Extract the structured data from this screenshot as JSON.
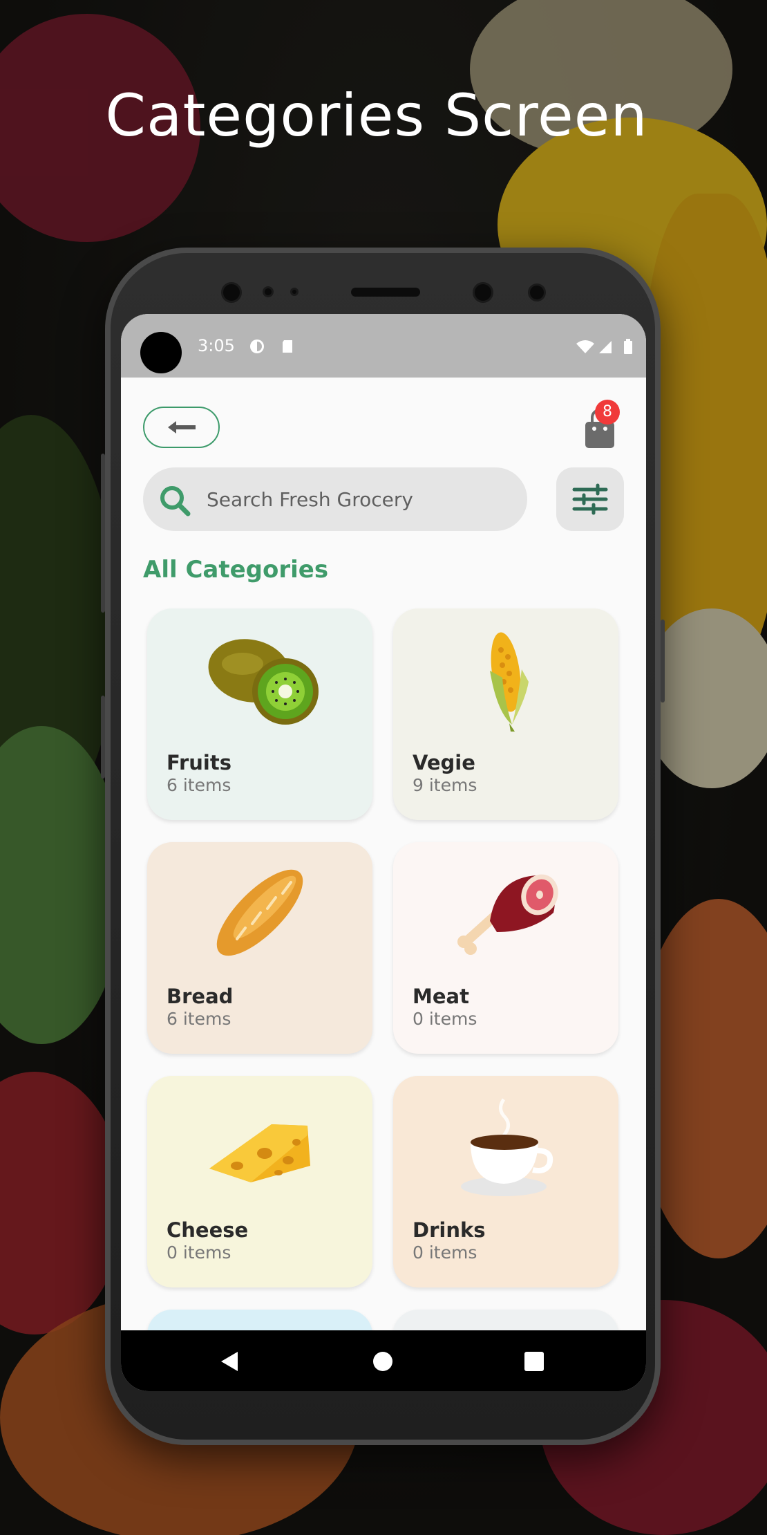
{
  "hero": {
    "title": "Categories Screen"
  },
  "status": {
    "time": "3:05"
  },
  "header": {
    "cart_count": "8"
  },
  "search": {
    "placeholder": "Search Fresh Grocery"
  },
  "section": {
    "title": "All Categories"
  },
  "categories": [
    {
      "name": "Fruits",
      "count": "6 items",
      "bg": "#ebf3f0",
      "icon": "kiwi-icon"
    },
    {
      "name": "Vegie",
      "count": "9 items",
      "bg": "#f2f2ea",
      "icon": "corn-icon"
    },
    {
      "name": "Bread",
      "count": "6 items",
      "bg": "#f5e9dc",
      "icon": "bread-icon"
    },
    {
      "name": "Meat",
      "count": "0 items",
      "bg": "#fcf6f4",
      "icon": "meat-icon"
    },
    {
      "name": "Cheese",
      "count": "0 items",
      "bg": "#f7f5dc",
      "icon": "cheese-icon"
    },
    {
      "name": "Drinks",
      "count": "0 items",
      "bg": "#f9e8d6",
      "icon": "coffee-icon"
    }
  ],
  "colors": {
    "accent": "#3f9b6a",
    "badge": "#f03a3a",
    "statusbar": "#b6b6b6"
  }
}
